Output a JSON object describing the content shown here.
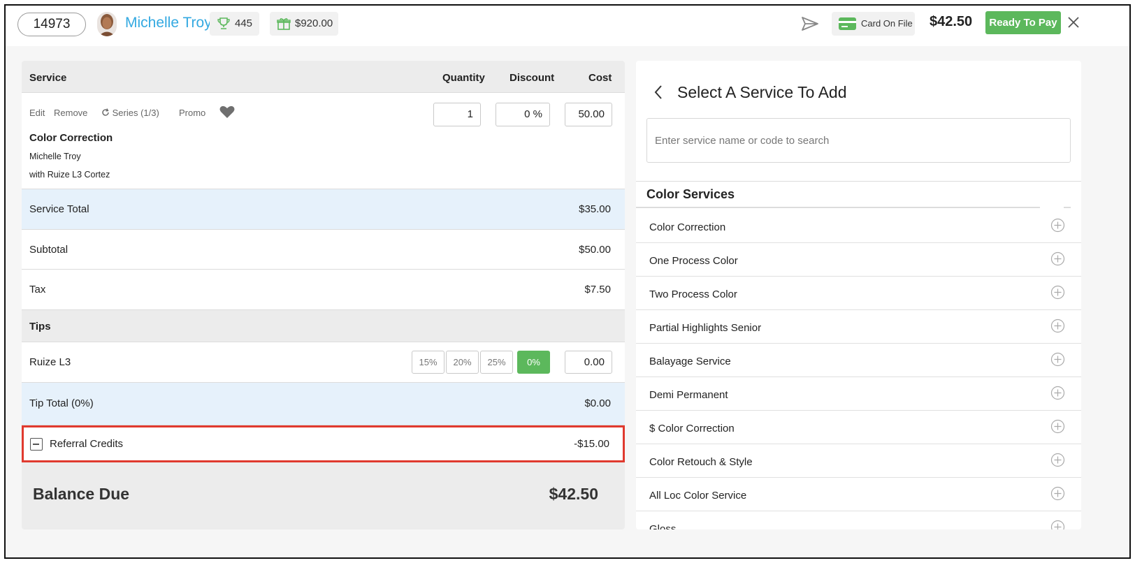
{
  "header": {
    "ticket_number": "14973",
    "client_name": "Michelle Troy",
    "points": "445",
    "gift_balance": "$920.00",
    "card_label": "Card On File",
    "total": "$42.50",
    "ready_label": "Ready To Pay"
  },
  "ticket": {
    "columns": {
      "service": "Service",
      "quantity": "Quantity",
      "discount": "Discount",
      "cost": "Cost"
    },
    "item": {
      "actions": {
        "edit": "Edit",
        "remove": "Remove",
        "series": "Series (1/3)",
        "promo": "Promo"
      },
      "name": "Color Correction",
      "client": "Michelle Troy",
      "staff": "with Ruize L3 Cortez",
      "quantity": "1",
      "discount": "0 %",
      "cost": "50.00"
    },
    "service_total": {
      "label": "Service Total",
      "value": "$35.00"
    },
    "subtotal": {
      "label": "Subtotal",
      "value": "$50.00"
    },
    "tax": {
      "label": "Tax",
      "value": "$7.50"
    },
    "tips": {
      "title": "Tips",
      "staff": "Ruize L3",
      "options": [
        "15%",
        "20%",
        "25%",
        "0%"
      ],
      "selected": "0%",
      "amount": "0.00"
    },
    "tip_total": {
      "label": "Tip Total (0%)",
      "value": "$0.00"
    },
    "referral": {
      "label": "Referral Credits",
      "value": "-$15.00"
    },
    "balance": {
      "label": "Balance Due",
      "value": "$42.50"
    }
  },
  "service_picker": {
    "title": "Select A Service To Add",
    "search_placeholder": "Enter service name or code to search",
    "category": "Color Services",
    "services": [
      "Color Correction",
      "One Process Color",
      "Two Process Color",
      "Partial Highlights Senior",
      "Balayage Service",
      "Demi Permanent",
      "$ Color Correction",
      "Color Retouch & Style",
      "All Loc Color Service",
      "Gloss"
    ]
  },
  "colors": {
    "accent_green": "#5cb85c",
    "client_blue": "#34a9e1",
    "highlight_red": "#e03a2f",
    "band_blue": "#e6f1fb"
  },
  "icons": [
    "trophy-icon",
    "gift-icon",
    "send-icon",
    "credit-card-icon",
    "close-icon",
    "refresh-icon",
    "heart-icon",
    "chevron-left-icon",
    "plus-circle-icon",
    "minus-square-icon"
  ]
}
